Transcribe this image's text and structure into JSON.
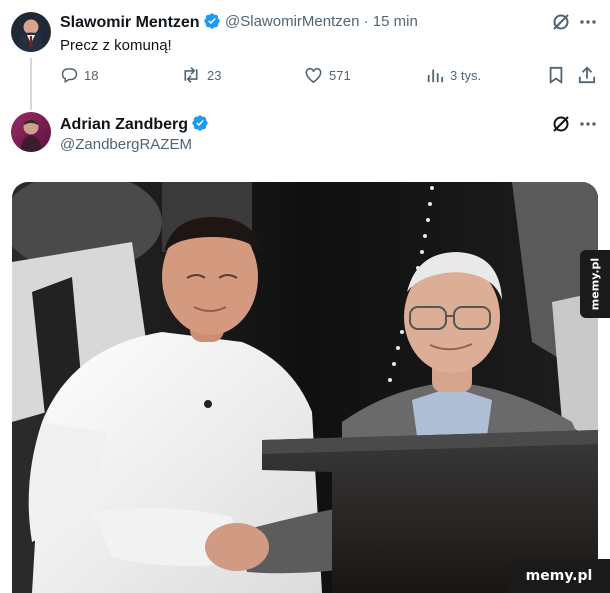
{
  "tweet1": {
    "name": "Slawomir Mentzen",
    "handle": "@SlawomirMentzen",
    "time": "· 15 min",
    "text": "Precz z komuną!",
    "stats": {
      "replies": "18",
      "reposts": "23",
      "likes": "571",
      "views": "3 tys."
    }
  },
  "tweet2": {
    "name": "Adrian Zandberg",
    "handle": "@ZandbergRAZEM"
  },
  "watermark": "memy.pl",
  "colors": {
    "verified": "#1d9bf0",
    "muted": "#536471",
    "text": "#0f1419",
    "thread_line": "#cfd9de"
  },
  "icons": [
    "grok-icon",
    "more-icon",
    "reply-icon",
    "repost-icon",
    "like-icon",
    "views-icon",
    "bookmark-icon",
    "share-icon",
    "verified-badge-icon"
  ]
}
